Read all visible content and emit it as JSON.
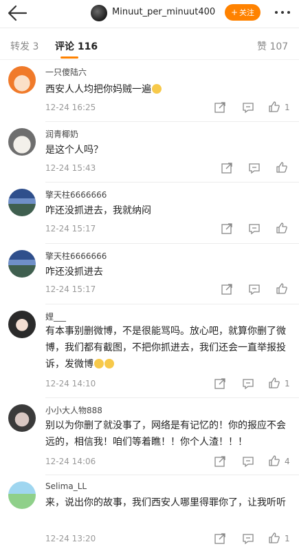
{
  "header": {
    "author_name": "Minuut_per_minuut400",
    "follow_label": "关注",
    "follow_plus": "+",
    "colors": {
      "accent": "#ff8200"
    }
  },
  "tabs": [
    {
      "label": "转发 3"
    },
    {
      "label": "评论 116"
    },
    {
      "label": "赞 107"
    }
  ],
  "comments": [
    {
      "user": "一只傻陆六",
      "text": "西安人人均把你妈贼一遍",
      "time": "12-24 16:25",
      "likes": "1",
      "avatar": "orange-cartoon-avatar"
    },
    {
      "user": "润青椰奶",
      "text": "是这个人吗？",
      "time": "12-24 15:43",
      "likes": "",
      "avatar": "husky-dog-avatar"
    },
    {
      "user": "擎天柱6666666",
      "text": "咋还没抓进去，我就纳闷",
      "time": "12-24 15:17",
      "likes": "",
      "avatar": "mountain-landscape-avatar"
    },
    {
      "user": "擎天柱6666666",
      "text": "咋还没抓进去",
      "time": "12-24 15:17",
      "likes": "",
      "avatar": "mountain-landscape-avatar"
    },
    {
      "user": "娌___",
      "text": "有本事别删微博，不是很能骂吗。放心吧，就算你删了微博，我们都有截图，不把你抓进去，我们还会一直举报投诉，发微博",
      "time": "12-24 14:10",
      "likes": "1",
      "avatar": "girl-photo-avatar"
    },
    {
      "user": "小小大人物888",
      "text": "别以为你删了就没事了，网络是有记忆的！你的报应不会远的，相信我！咱们等着瞧！！你个人渣！！！",
      "time": "12-24 14:06",
      "likes": "4",
      "avatar": "headphones-avatar"
    },
    {
      "user": "Selima_LL",
      "text": "来，说出你的故事，我们西安人哪里得罪你了，让我听听",
      "time": "12-24 13:20",
      "likes": "1",
      "avatar": "landscape-avatar"
    }
  ]
}
